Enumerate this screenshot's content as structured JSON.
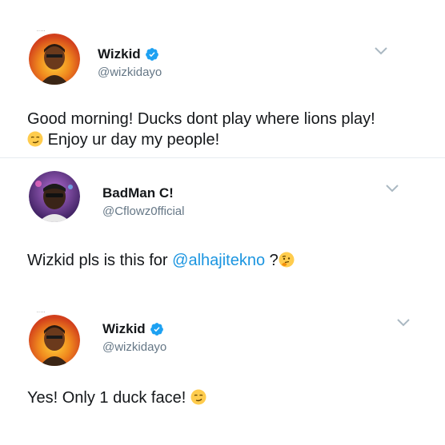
{
  "tweets": [
    {
      "name": "Wizkid",
      "handle": "@wizkidayo",
      "verified": true,
      "text_line1": "Good morning! Ducks dont play where lions play!",
      "text_line2": "Enjoy ur day my people!",
      "emoji_line2": "smirk-emoji"
    },
    {
      "name": "BadMan C!",
      "handle": "@Cflowz0fficial",
      "verified": false,
      "text_before": "Wizkid pls is this for ",
      "mention": "@alhajitekno",
      "text_after": " ?",
      "emoji_end": "thinking-emoji"
    },
    {
      "name": "Wizkid",
      "handle": "@wizkidayo",
      "verified": true,
      "text_line1": "Yes! Only 1 duck face! ",
      "emoji_end": "smirk-emoji"
    }
  ],
  "colors": {
    "name": "#14171a",
    "handle": "#657786",
    "mention": "#1b95e0",
    "verified": "#1da1f2",
    "divider": "#e6ecf0",
    "chevron": "#aab8c2"
  }
}
